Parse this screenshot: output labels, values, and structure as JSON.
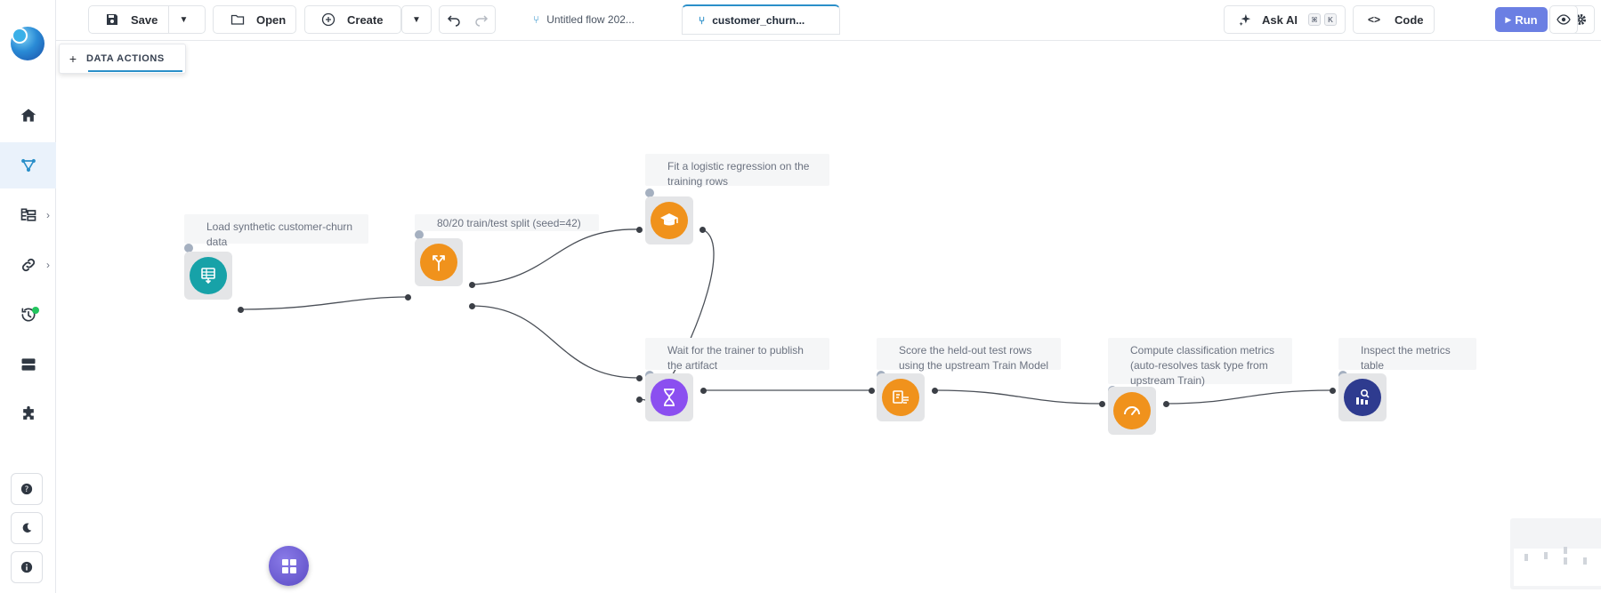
{
  "toolbar": {
    "save_label": "Save",
    "open_label": "Open",
    "create_label": "Create",
    "ask_ai_label": "Ask AI",
    "ask_ai_shortcut": [
      "⌘",
      "K"
    ],
    "code_label": "Code",
    "run_label": "Run"
  },
  "tabs": [
    {
      "label": "Untitled flow 202...",
      "active": false
    },
    {
      "label": "customer_churn...",
      "active": true
    }
  ],
  "data_actions": {
    "label": "DATA ACTIONS"
  },
  "nodes": [
    {
      "note": "Load synthetic customer-churn data",
      "icon": "table-import-icon",
      "color": "#17a2a8"
    },
    {
      "note": "80/20 train/test split (seed=42)",
      "icon": "split-icon",
      "color": "#f0921c"
    },
    {
      "note": "Fit a logistic regression on the training rows",
      "icon": "graduation-cap-icon",
      "color": "#f0921c"
    },
    {
      "note": "Wait for the trainer to publish the artifact",
      "icon": "hourglass-icon",
      "color": "#8b4ff0"
    },
    {
      "note": "Score the held-out test rows using the upstream Train Model",
      "icon": "score-icon",
      "color": "#f0921c"
    },
    {
      "note": "Compute classification metrics (auto-resolves task type from upstream Train)",
      "icon": "gauge-icon",
      "color": "#f0921c"
    },
    {
      "note": "Inspect the metrics table",
      "icon": "chart-inspect-icon",
      "color": "#2e3b8f"
    }
  ],
  "colors": {
    "accent": "#2b8fc9",
    "run": "#6b7fe3"
  }
}
